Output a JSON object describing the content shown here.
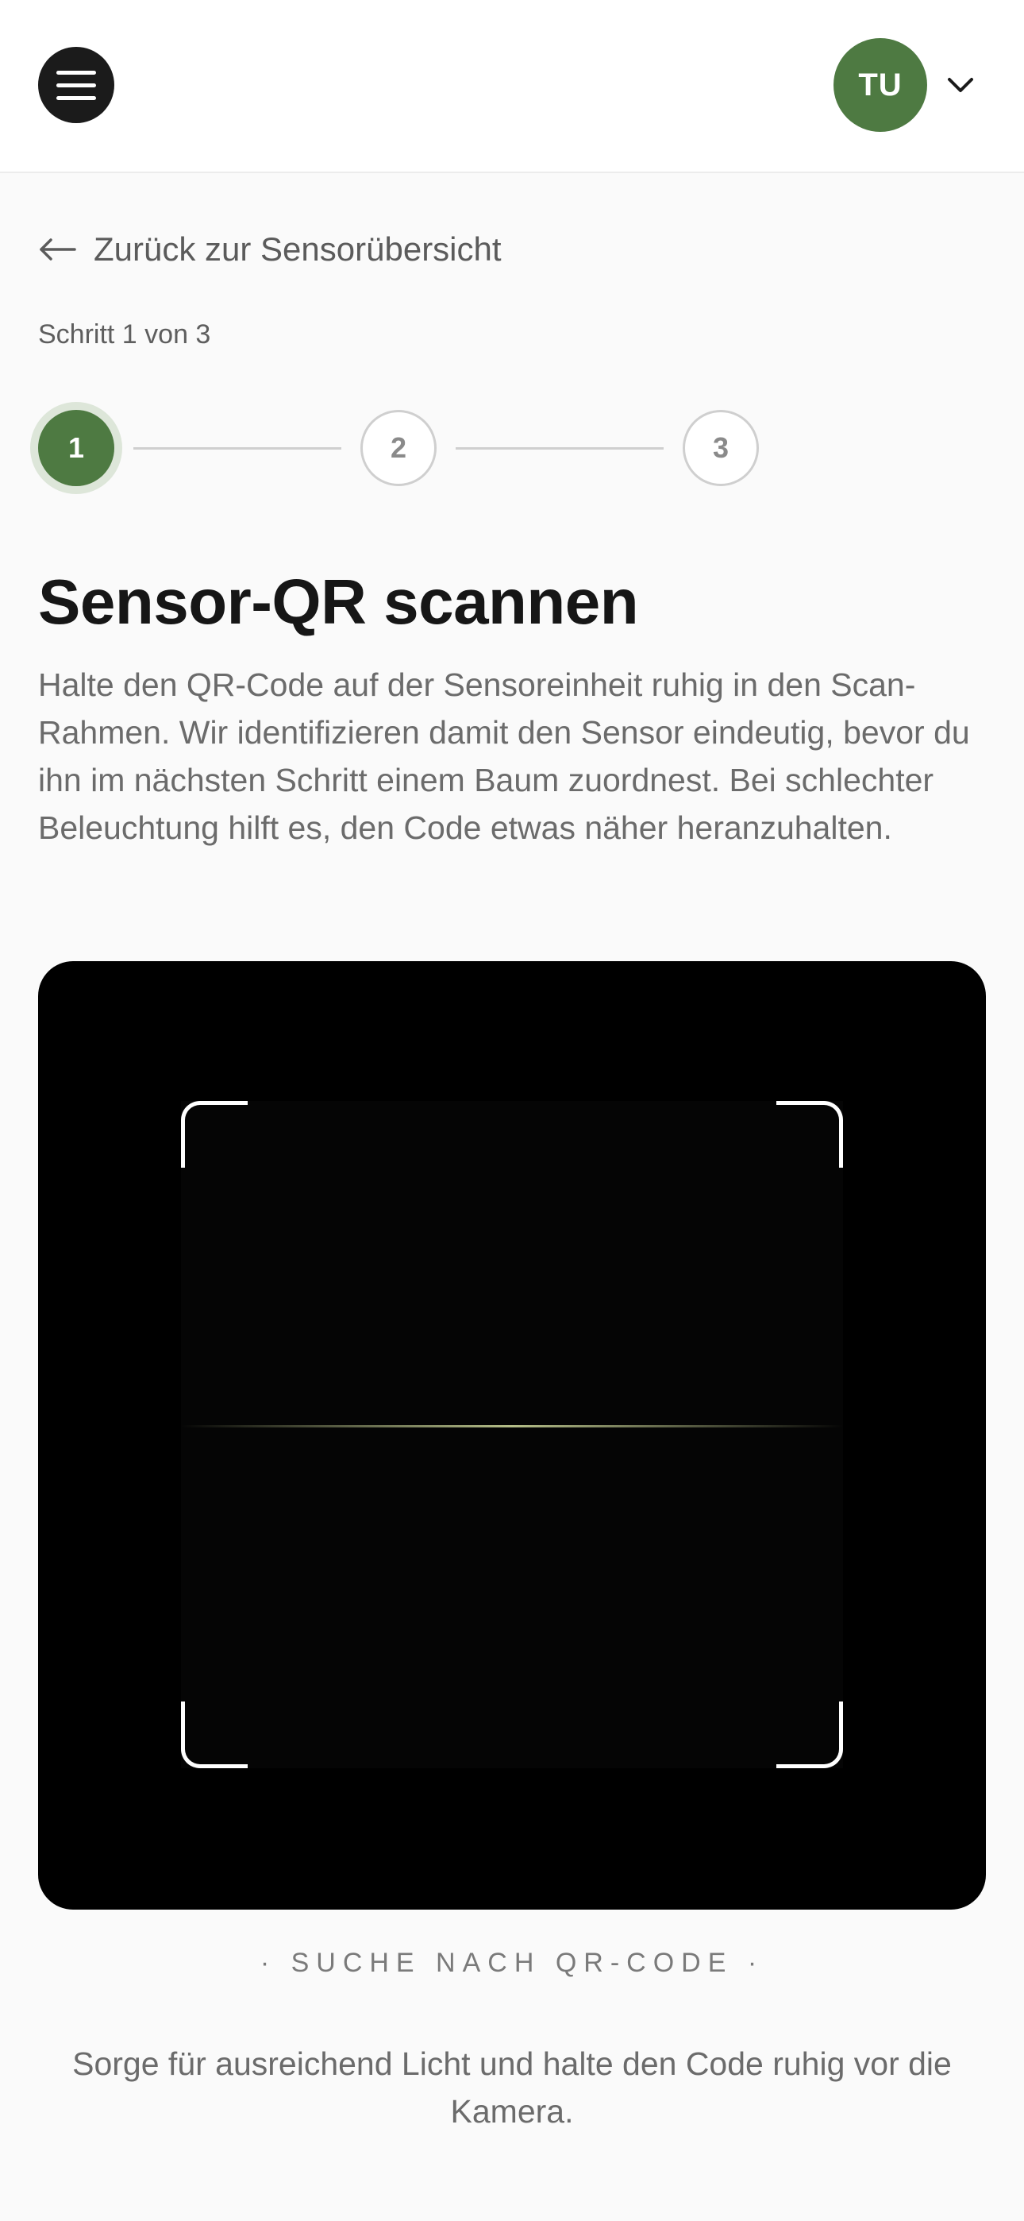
{
  "header": {
    "menu_icon": "hamburger-menu-icon",
    "avatar_initials": "TU",
    "avatar_color": "#4e7a42",
    "dropdown_icon": "chevron-down-icon"
  },
  "back_link": {
    "icon": "arrow-left-icon",
    "label": "Zurück zur Sensorübersicht"
  },
  "stepper": {
    "progress_text": "Schritt 1 von 3",
    "current_step": 1,
    "steps": [
      {
        "label": "1",
        "state": "active"
      },
      {
        "label": "2",
        "state": "idle"
      },
      {
        "label": "3",
        "state": "idle"
      }
    ]
  },
  "main": {
    "title": "Sensor-QR scannen",
    "description": "Halte den QR-Code auf der Sensoreinheit ruhig in den Scan-Rahmen. Wir identifizieren damit den Sensor eindeutig, bevor du ihn im nächsten Schritt einem Baum zuordnest. Bei schlechter Beleuchtung hilft es, den Code etwas näher heranzuhalten."
  },
  "scanner": {
    "status": "· SUCHE NACH QR-CODE ·",
    "hint": "Sorge für ausreichend Licht und halte den Code ruhig vor die Kamera."
  },
  "colors": {
    "accent": "#4e7a42",
    "background": "#fafafa",
    "scanner_background": "#000000"
  }
}
